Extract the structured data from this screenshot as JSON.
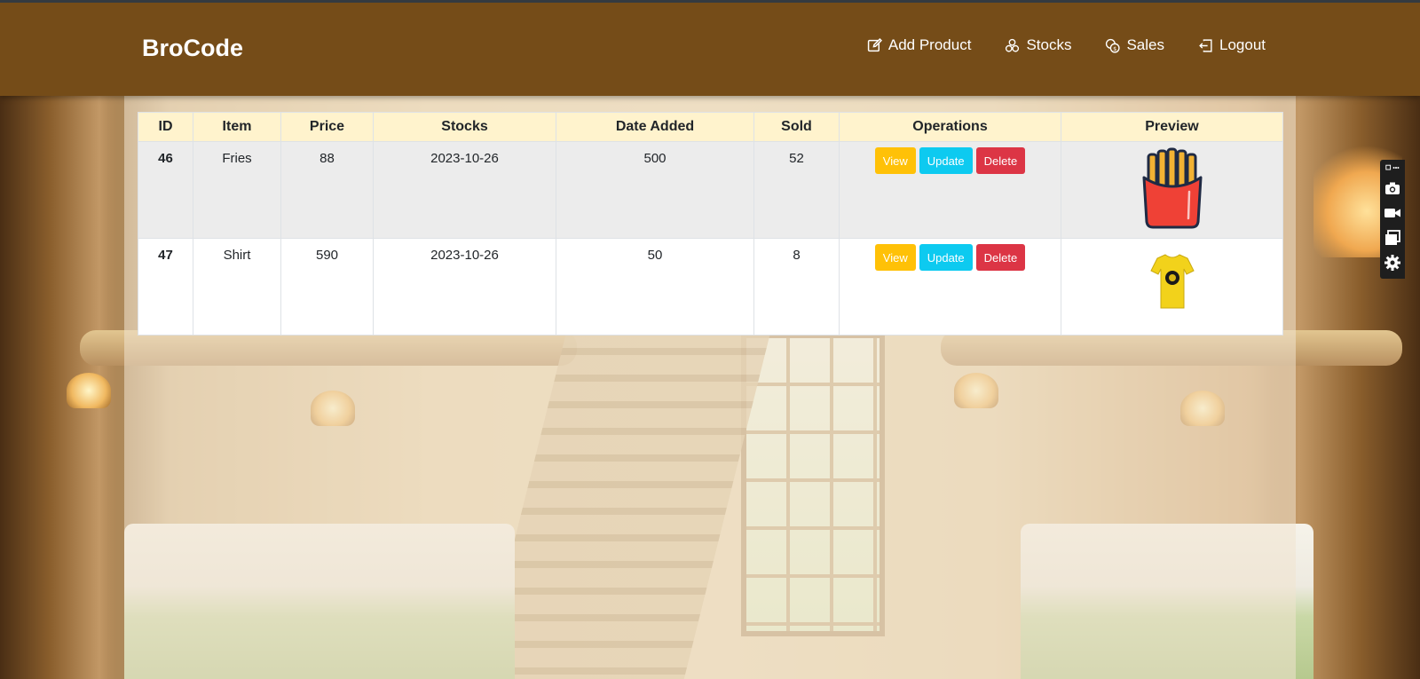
{
  "brand": "BroCode",
  "nav": {
    "add_product": "Add Product",
    "stocks": "Stocks",
    "sales": "Sales",
    "logout": "Logout"
  },
  "table": {
    "headers": [
      "ID",
      "Item",
      "Price",
      "Stocks",
      "Date Added",
      "Sold",
      "Operations",
      "Preview"
    ],
    "rows": [
      {
        "id": "46",
        "item": "Fries",
        "price": "88",
        "stocks": "2023-10-26",
        "date_added": "500",
        "sold": "52",
        "preview": "fries-icon"
      },
      {
        "id": "47",
        "item": "Shirt",
        "price": "590",
        "stocks": "2023-10-26",
        "date_added": "50",
        "sold": "8",
        "preview": "tshirt-icon"
      }
    ],
    "buttons": {
      "view": "View",
      "update": "Update",
      "delete": "Delete"
    }
  },
  "colors": {
    "navbar": "#754c18",
    "header_bg": "#fff3cd",
    "view": "#ffc107",
    "update": "#0dcaf0",
    "delete": "#dc3545"
  }
}
